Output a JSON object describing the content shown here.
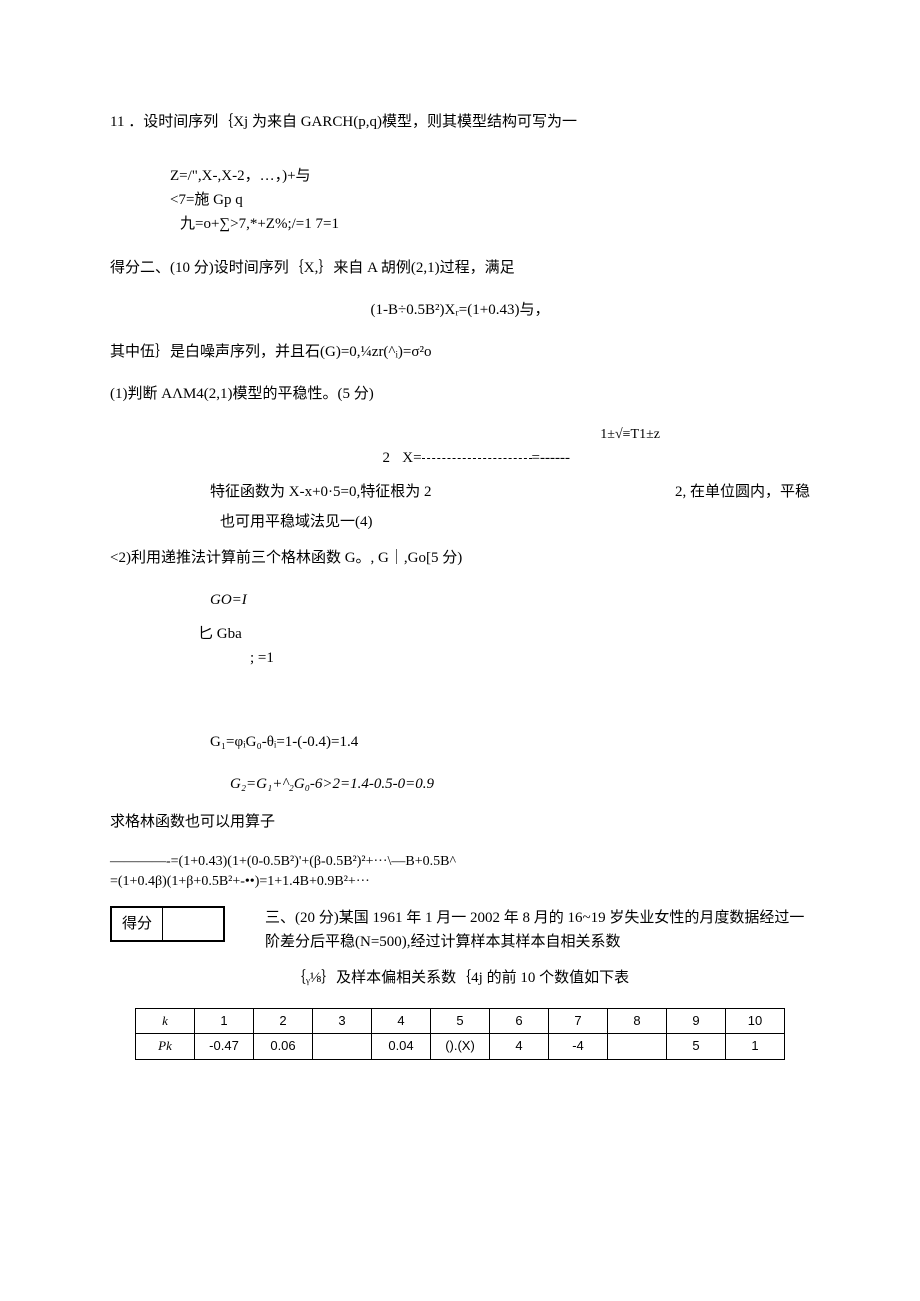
{
  "q11": {
    "prompt": "11 ．设时间序列｛Xj 为来自 GARCH(p,q)模型，则其模型结构可写为一",
    "line1": "Z=/\",X-,X-2，…，)+与",
    "line2": "<7=施 Gp  q",
    "line3": "九=o+∑>7,*+Z%;/=1 7=1"
  },
  "q2": {
    "intro": "得分二、(10 分)设时间序列｛X,｝来自 A 胡例(2,1)过程，满足",
    "eq": "(1-B÷0.5B²)Xᵣ=(1+0.43)与，",
    "noise": "其中伍｝是白噪声序列，并且石(G)=0,¼zr(^ᵢ)=σ²o",
    "part1": "(1)判断 AΛM4(2,1)模型的平稳性。(5 分)",
    "char_left": "特征函数为 X-x+0·5=0,特征根为 2",
    "char_num2": "2",
    "char_top": "1±√≡T1±z",
    "char_x": "X=",
    "char_eq": "=",
    "char_dash": "------",
    "char_right": "2, 在单位圆内，平稳",
    "char_note": "也可用平稳域法见一(4)",
    "part2": "<2)利用递推法计算前三个格林函数 G。, G｜,Go[5 分)",
    "g0": "GO=I",
    "gba": "匕 Gba",
    "geq1": ";  =1",
    "g1": "G₁=φᵢG₀-θᵢ=1-(-0.4)=1.4",
    "g2": "G₂=G₁+^₂G₀-6>2=1.4-0.5-0=0.9",
    "op_intro": "求格林函数也可以用算子",
    "op_l1": "————-=(1+0.43)(1+(0-0.5B²)'+(β-0.5B²)²+···\\—B+0.5B^",
    "op_l2": "=(1+0.4β)(1+β+0.5B²+-••)=1+1.4B+0.9B²+···"
  },
  "q3": {
    "score_label": "得分",
    "text1": "三、(20 分)某国 1961 年 1 月一 2002 年 8 月的 16~19 岁失业女性的月度数据经过一阶差分后平稳(N=500),经过计算样本其样本自相关系数",
    "text2": "｛ᵧ⅛｝及样本偏相关系数｛4j 的前 10 个数值如下表"
  },
  "table": {
    "headers": [
      "k",
      "1",
      "2",
      "3",
      "4",
      "5",
      "6",
      "7",
      "8",
      "9",
      "10"
    ],
    "row_label": "Pk",
    "row": [
      "-0.47",
      "0.06",
      "",
      "0.04",
      "().(X)",
      "4",
      "-4",
      "",
      "5",
      "1"
    ]
  }
}
